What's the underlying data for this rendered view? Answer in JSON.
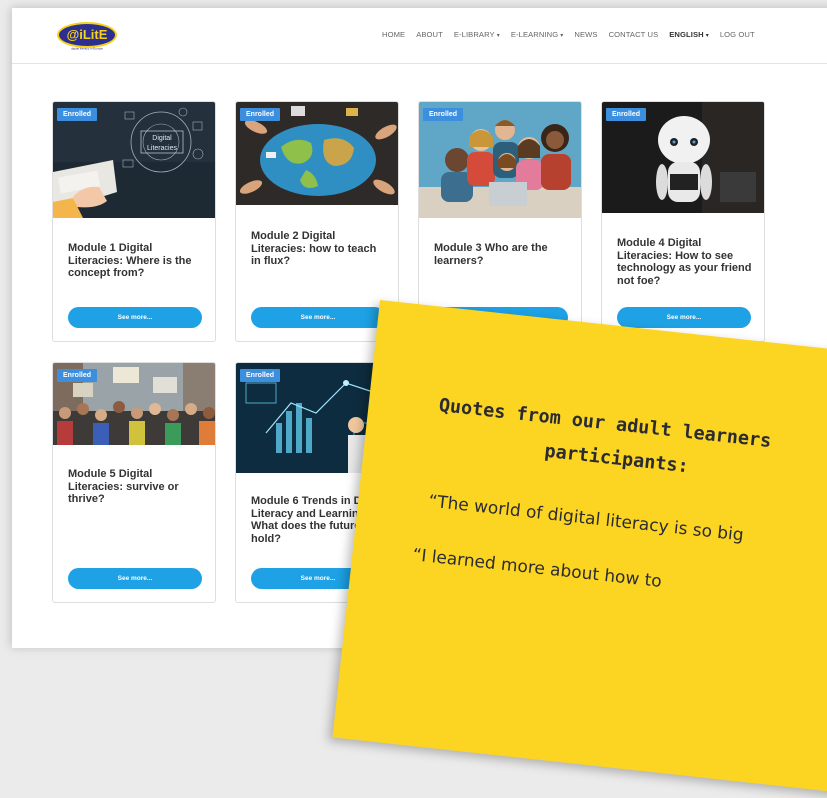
{
  "header": {
    "logo_text": "@iLitE",
    "logo_tagline": "digital literacy in Europe",
    "nav": [
      {
        "label": "HOME",
        "dropdown": false,
        "bold": false
      },
      {
        "label": "ABOUT",
        "dropdown": false,
        "bold": false
      },
      {
        "label": "E-LIBRARY",
        "dropdown": true,
        "bold": false
      },
      {
        "label": "E-LEARNING",
        "dropdown": true,
        "bold": false
      },
      {
        "label": "NEWS",
        "dropdown": false,
        "bold": false
      },
      {
        "label": "CONTACT US",
        "dropdown": false,
        "bold": false
      },
      {
        "label": "ENGLISH",
        "dropdown": true,
        "bold": true
      },
      {
        "label": "LOG OUT",
        "dropdown": false,
        "bold": false
      }
    ]
  },
  "modules": [
    {
      "badge": "Enrolled",
      "title": "Module 1 Digital Literacies: Where is the concept from?",
      "button": "See more...",
      "image_overlay": [
        "Digital",
        "Literacies"
      ]
    },
    {
      "badge": "Enrolled",
      "title": "Module 2 Digital Literacies: how to teach in flux?",
      "button": "See more..."
    },
    {
      "badge": "Enrolled",
      "title": "Module 3 Who are the learners?",
      "button": "See more..."
    },
    {
      "badge": "Enrolled",
      "title": "Module 4 Digital Literacies: How to see technology as your friend not foe?",
      "button": "See more..."
    },
    {
      "badge": "Enrolled",
      "title": "Module 5 Digital Literacies: survive or thrive?",
      "button": "See more..."
    },
    {
      "badge": "Enrolled",
      "title": "Module 6 Trends in Digital Literacy and Learning: What does the future hold?",
      "button": "See more..."
    }
  ],
  "quote_card": {
    "title_line1": "Quotes from our adult learners",
    "title_line2": "participants:",
    "quote1": "“The world of digital literacy is so big",
    "quote2": "“I learned more about how to"
  },
  "colors": {
    "badge": "#3c8edf",
    "button": "#1ea1e5",
    "quote_card": "#fcd422",
    "logo_blue": "#2b2f8f",
    "logo_yellow": "#f7d117"
  }
}
